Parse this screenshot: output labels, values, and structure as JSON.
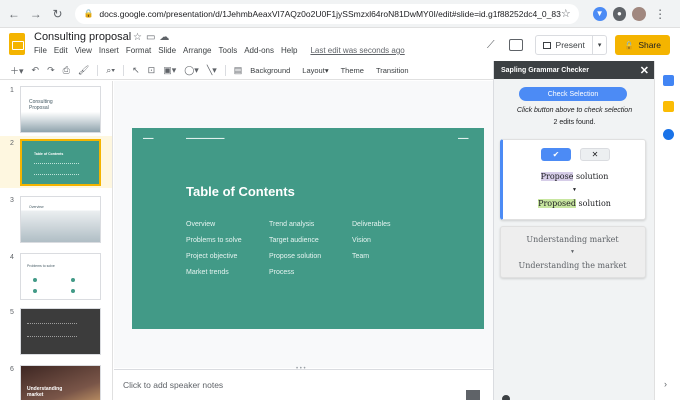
{
  "browser": {
    "url": "docs.google.com/presentation/d/1JehmbAeaxVI7AQz0o2U0F1jySSmzxl64roN81DwMY0I/edit#slide=id.g1f88252dc4_0_83"
  },
  "doc": {
    "title": "Consulting proposal",
    "menus": [
      "File",
      "Edit",
      "View",
      "Insert",
      "Format",
      "Slide",
      "Arrange",
      "Tools",
      "Add-ons",
      "Help"
    ],
    "saved_status": "Last edit was seconds ago",
    "present_label": "Present",
    "share_label": "Share"
  },
  "toolbar": {
    "background_label": "Background",
    "layout_label": "Layout",
    "theme_label": "Theme",
    "transition_label": "Transition"
  },
  "filmstrip": {
    "slides": [
      {
        "num": "1",
        "title": "Consulting Proposal"
      },
      {
        "num": "2",
        "title": "Table of Contents"
      },
      {
        "num": "3",
        "title": "Overview"
      },
      {
        "num": "4",
        "title": "Problems to solve"
      },
      {
        "num": "5",
        "title": ""
      },
      {
        "num": "6",
        "title": "Understanding market"
      }
    ]
  },
  "slide": {
    "title": "Table of Contents",
    "columns": [
      [
        "Overview",
        "Problems to solve",
        "Project objective",
        "Market trends"
      ],
      [
        "Trend analysis",
        "Target audience",
        "Propose solution",
        "Process"
      ],
      [
        "Deliverables",
        "Vision",
        "Team"
      ]
    ]
  },
  "notes": {
    "placeholder": "Click to add speaker notes"
  },
  "sapling": {
    "header": "Sapling Grammar Checker",
    "check_button": "Check Selection",
    "instruction": "Click button above to check selection",
    "edit_count": "2 edits found.",
    "edits": [
      {
        "original_hl": "Propose",
        "original_rest": " solution",
        "corrected_hl": "Proposed",
        "corrected_rest": " solution"
      },
      {
        "original": "Understanding market",
        "corrected": "Understanding the market"
      }
    ]
  },
  "colors": {
    "slide_bg": "#429a87",
    "accent_yellow": "#f4b400",
    "sapling_blue": "#4c8bf5"
  }
}
